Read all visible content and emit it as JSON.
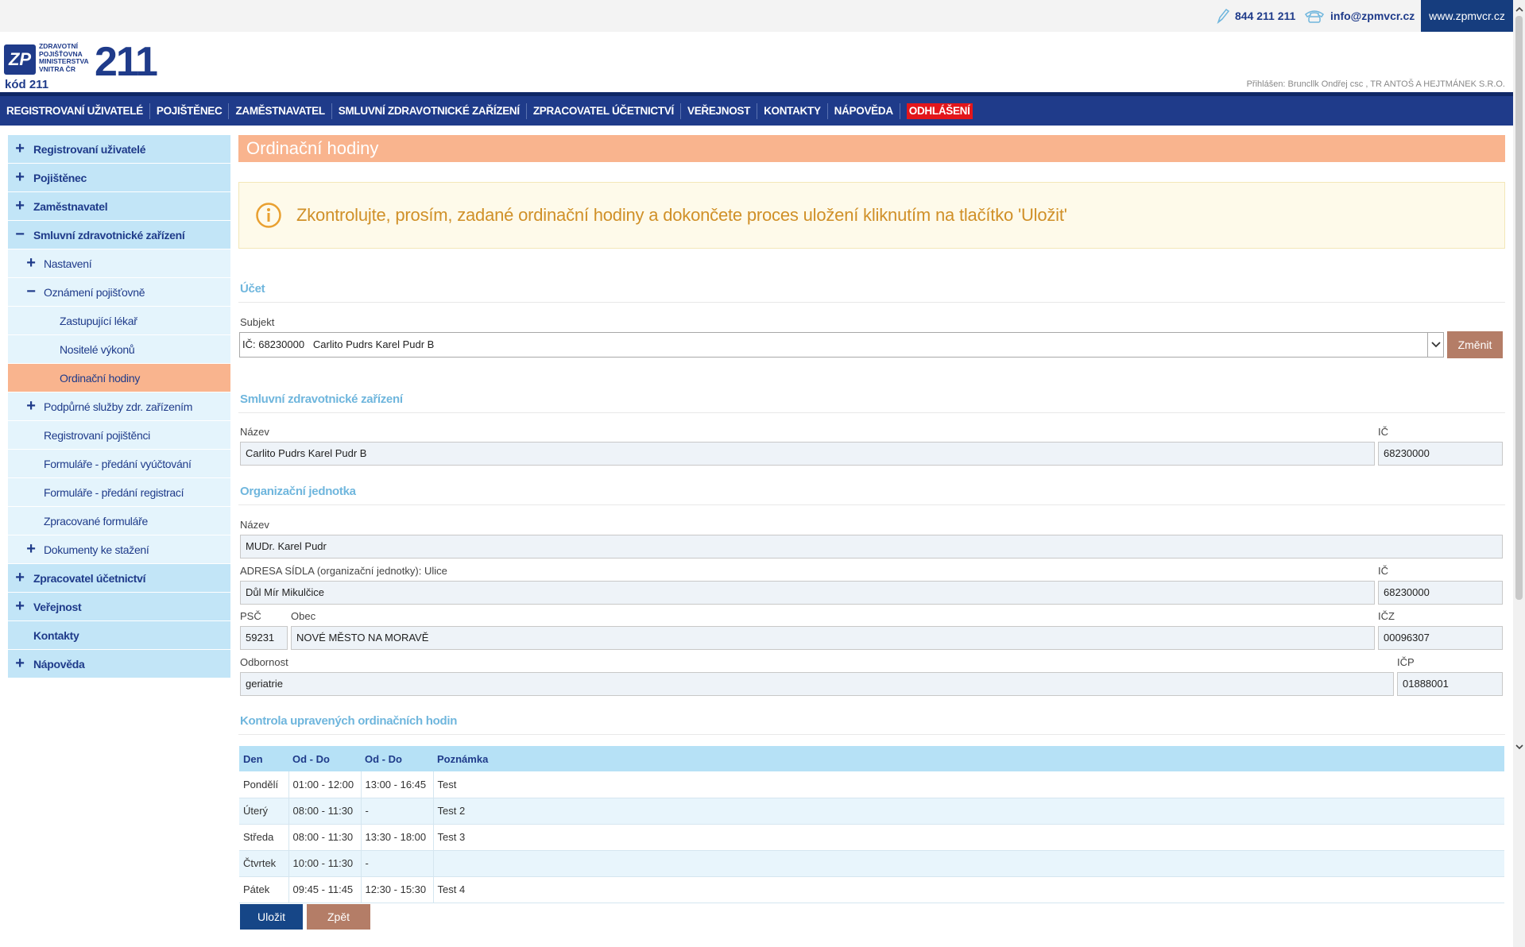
{
  "topbar": {
    "phone": "844 211 211",
    "email": "info@zpmvcr.cz",
    "website": "www.zpmvcr.cz"
  },
  "header": {
    "logo_lines": [
      "ZDRAVOTNÍ",
      "POJIŠŤOVNA",
      "MINISTERSTVA",
      "VNITRA ČR"
    ],
    "logo_number": "211",
    "logo_code": "kód 211",
    "logo_mark": "ZP",
    "logged_in": "Přihlášen: Bruncllk Ondřej csc , TR ANTOŠ A HEJTMÁNEK S.R.O."
  },
  "nav": {
    "items": [
      "REGISTROVANÍ UŽIVATELÉ",
      "POJIŠTĚNEC",
      "ZAMĚSTNAVATEL",
      "SMLUVNÍ ZDRAVOTNICKÉ ZAŘÍZENÍ",
      "ZPRACOVATEL ÚČETNICTVÍ",
      "VEŘEJNOST",
      "KONTAKTY",
      "NÁPOVĚDA"
    ],
    "logout": "ODHLÁŠENÍ"
  },
  "sidebar": {
    "items": [
      {
        "label": "Registrovaní uživatelé",
        "sign": "+"
      },
      {
        "label": "Pojištěnec",
        "sign": "+"
      },
      {
        "label": "Zaměstnavatel",
        "sign": "+"
      },
      {
        "label": "Smluvní zdravotnické zařízení",
        "sign": "−"
      },
      {
        "label": "Nastavení",
        "sign": "+"
      },
      {
        "label": "Oznámení pojišťovně",
        "sign": "−"
      },
      {
        "label": "Zastupující lékař",
        "sign": ""
      },
      {
        "label": "Nositelé výkonů",
        "sign": ""
      },
      {
        "label": "Ordinační hodiny",
        "sign": ""
      },
      {
        "label": "Podpůrné služby zdr. zařízením",
        "sign": "+"
      },
      {
        "label": "Registrovaní pojištěnci",
        "sign": ""
      },
      {
        "label": "Formuláře - předání vyúčtování",
        "sign": ""
      },
      {
        "label": "Formuláře - předání registrací",
        "sign": ""
      },
      {
        "label": "Zpracované formuláře",
        "sign": ""
      },
      {
        "label": "Dokumenty ke stažení",
        "sign": "+"
      },
      {
        "label": "Zpracovatel účetnictví",
        "sign": "+"
      },
      {
        "label": "Veřejnost",
        "sign": "+"
      },
      {
        "label": "Kontakty",
        "sign": ""
      },
      {
        "label": "Nápověda",
        "sign": "+"
      }
    ]
  },
  "page": {
    "title": "Ordinační hodiny",
    "alert": "Zkontrolujte, prosím, zadané ordinační hodiny a dokončete proces uložení kliknutím na tlačítko 'Uložit'"
  },
  "ucet": {
    "heading": "Účet",
    "subject_label": "Subjekt",
    "subject_value": "IČ: 68230000   Carlito Pudrs Karel Pudr B",
    "change_button": "Změnit"
  },
  "szz": {
    "heading": "Smluvní zdravotnické zařízení",
    "name_label": "Název",
    "name_value": "Carlito Pudrs Karel Pudr B",
    "ic_label": "IČ",
    "ic_value": "68230000"
  },
  "oj": {
    "heading": "Organizační jednotka",
    "name_label": "Název",
    "name_value": "MUDr. Karel Pudr",
    "address_label": "ADRESA SÍDLA (organizační jednotky): Ulice",
    "address_value": "Důl Mír Mikulčice",
    "ic_label": "IČ",
    "ic_value": "68230000",
    "psc_label": "PSČ",
    "psc_value": "59231",
    "obec_label": "Obec",
    "obec_value": "NOVÉ MĚSTO NA MORAVĚ",
    "icz_label": "IČZ",
    "icz_value": "00096307",
    "odbornost_label": "Odbornost",
    "odbornost_value": "geriatrie",
    "icp_label": "IČP",
    "icp_value": "01888001"
  },
  "hours": {
    "heading": "Kontrola upravených ordinačních hodin",
    "columns": [
      "Den",
      "Od - Do",
      "Od - Do",
      "Poznámka"
    ],
    "rows": [
      [
        "Pondělí",
        "01:00 - 12:00",
        "13:00 - 16:45",
        "Test"
      ],
      [
        "Úterý",
        "08:00 - 11:30",
        "-",
        "Test 2"
      ],
      [
        "Středa",
        "08:00 - 11:30",
        "13:30 - 18:00",
        "Test 3"
      ],
      [
        "Čtvrtek",
        "10:00 - 11:30",
        "-",
        ""
      ],
      [
        "Pátek",
        "09:45 - 11:45",
        "12:30 - 15:30",
        "Test 4"
      ]
    ],
    "save_button": "Uložit",
    "back_button": "Zpět"
  },
  "colors": {
    "brand_blue": "#1f3b8a",
    "accent_orange": "#f9b48e",
    "logout_red": "#e3161b",
    "alert_text": "#d09028",
    "section_heading": "#6fb6dd"
  }
}
